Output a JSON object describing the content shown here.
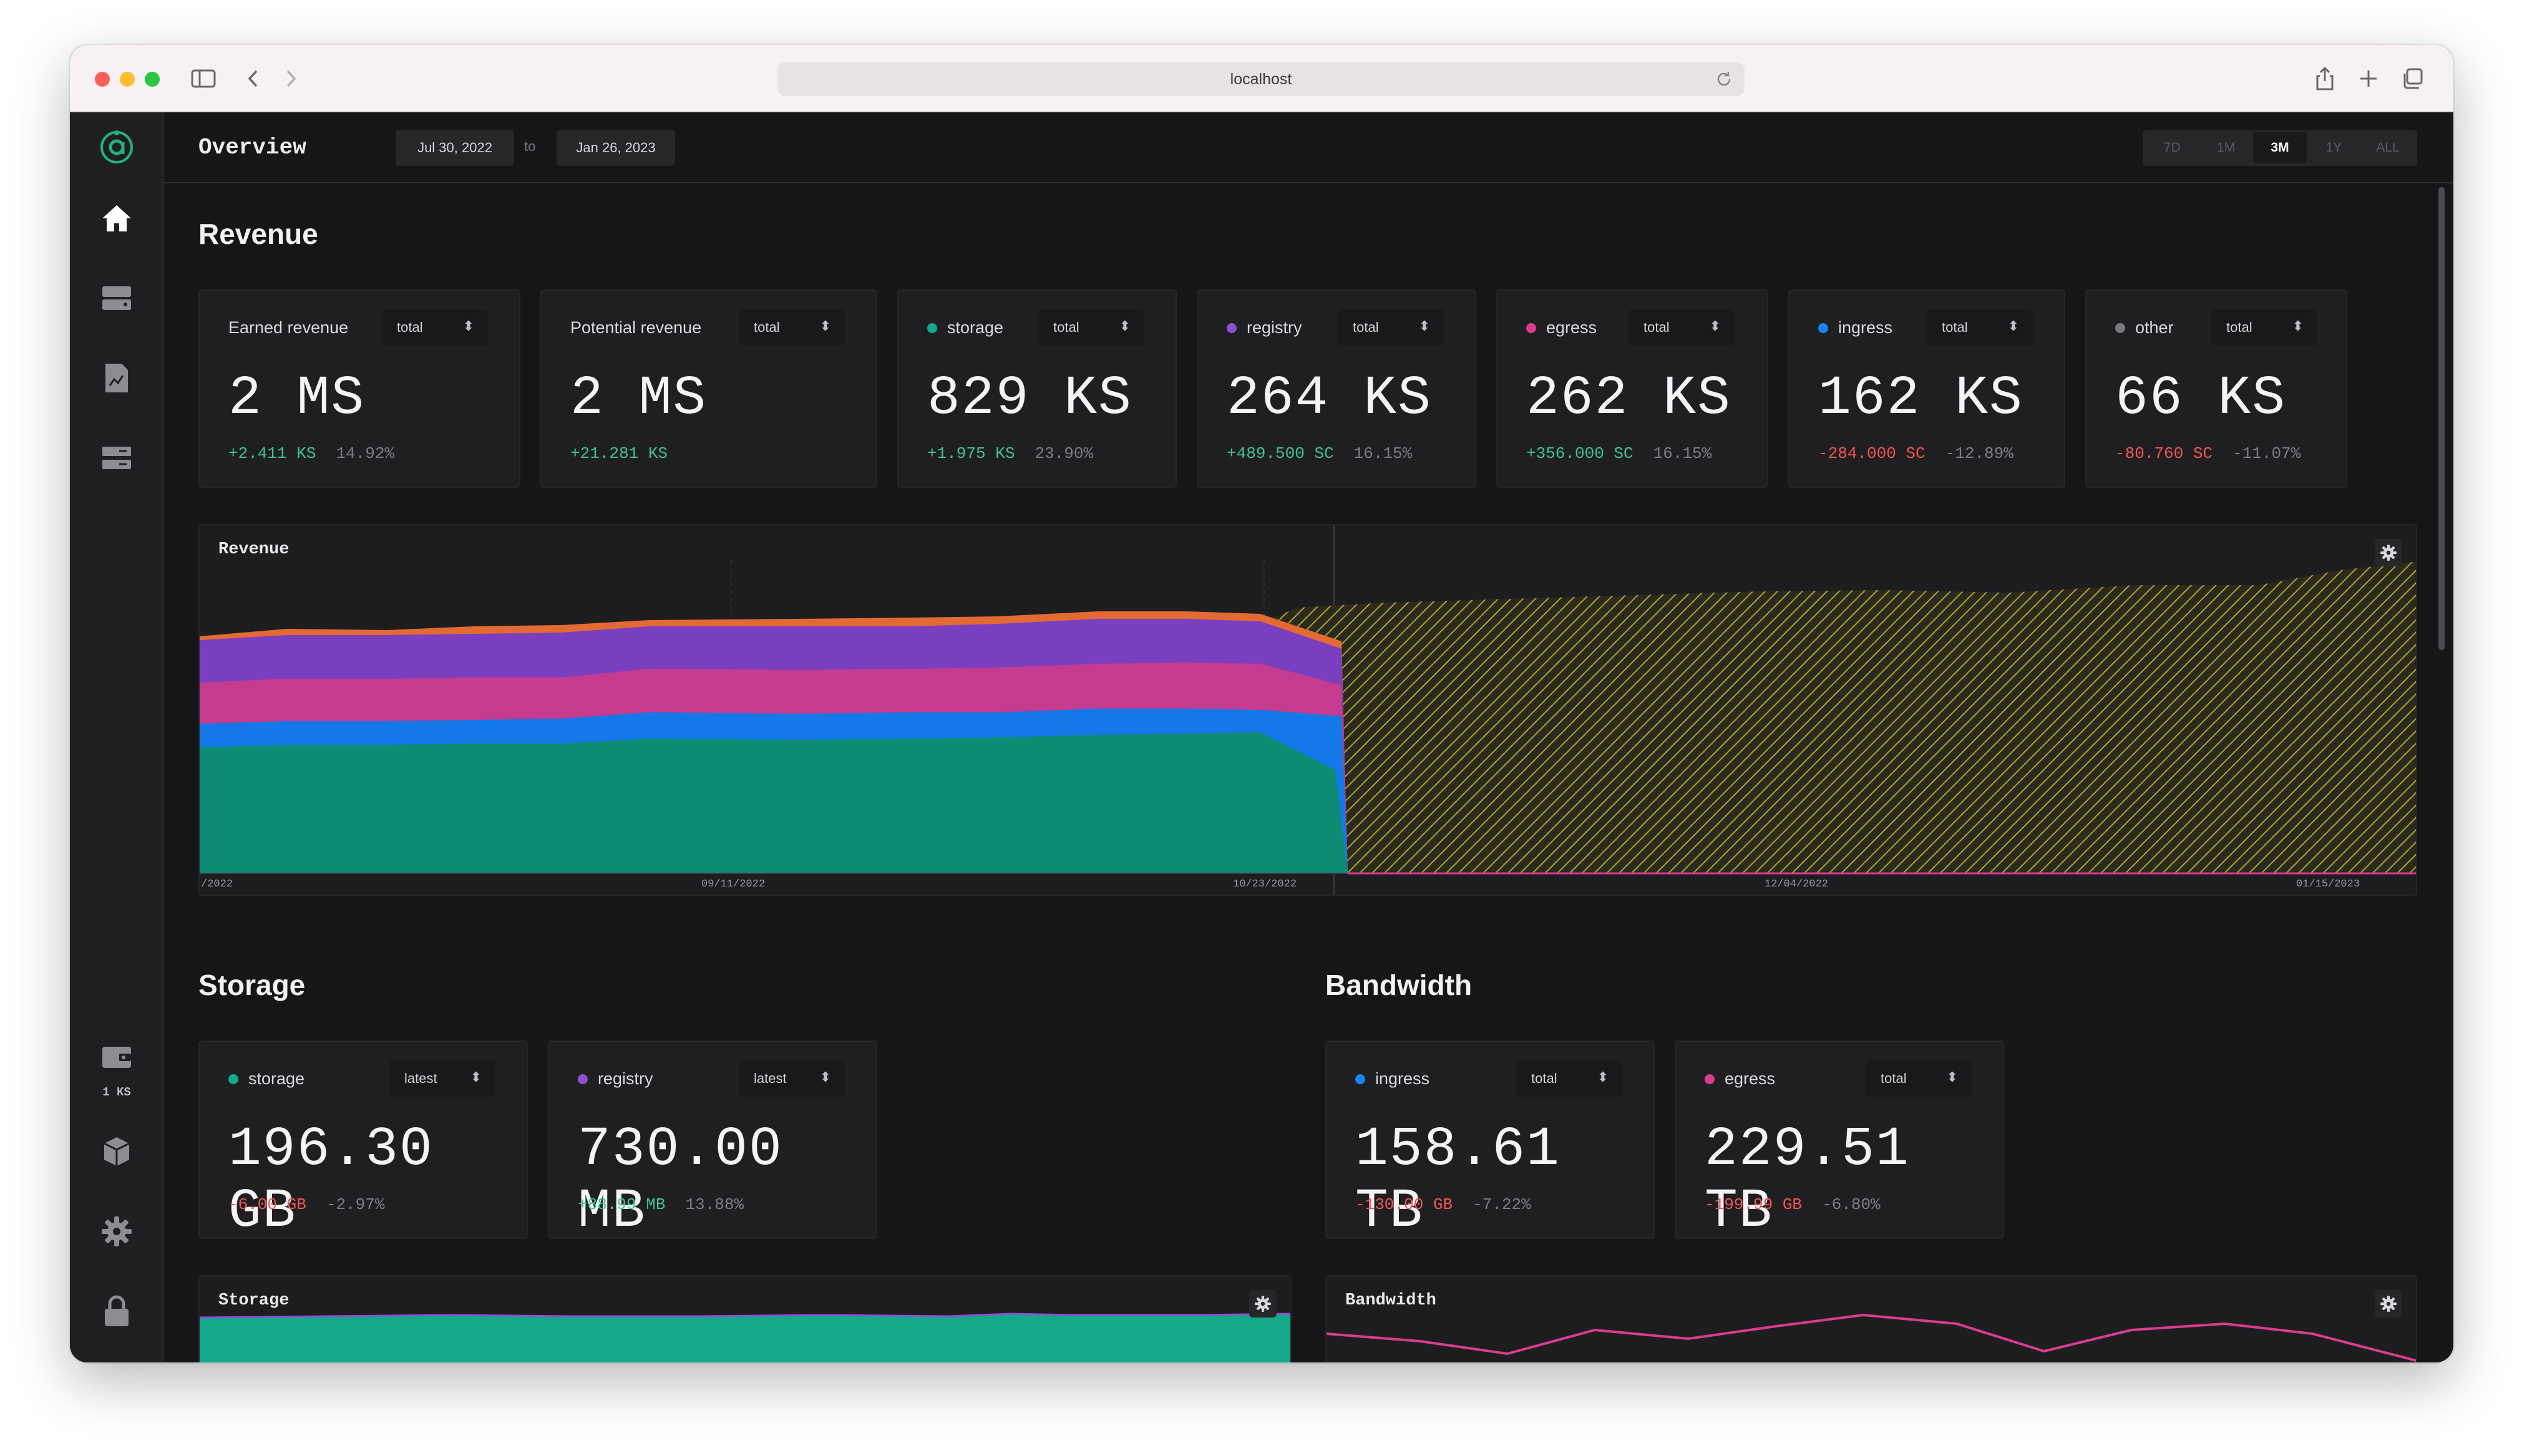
{
  "browser": {
    "url": "localhost",
    "colors": {
      "close": "#ff5f57",
      "minimize": "#febc2e",
      "zoom": "#28c840"
    }
  },
  "sidebar": {
    "items": [
      {
        "icon": "logo-icon"
      },
      {
        "icon": "home-icon",
        "active": true
      },
      {
        "icon": "storage-icon"
      },
      {
        "icon": "contracts-icon"
      },
      {
        "icon": "volumes-icon"
      }
    ],
    "bottom": [
      {
        "icon": "wallet-icon",
        "label": "1 KS"
      },
      {
        "icon": "box-icon"
      },
      {
        "icon": "gear-icon"
      },
      {
        "icon": "lock-icon"
      }
    ]
  },
  "header": {
    "title": "Overview",
    "date_from": "Jul 30, 2022",
    "date_to_label": "to",
    "date_to": "Jan 26, 2023",
    "periods": [
      "7D",
      "1M",
      "3M",
      "1Y",
      "ALL"
    ],
    "active_period": "3M"
  },
  "revenue": {
    "title": "Revenue",
    "cards": [
      {
        "label": "Earned revenue",
        "selector": "total",
        "value": "2 MS",
        "delta": "+2.411 KS",
        "pct": "14.92%",
        "trend": "pos",
        "dot": null
      },
      {
        "label": "Potential revenue",
        "selector": "total",
        "value": "2 MS",
        "delta": "+21.281 KS",
        "pct": "",
        "trend": "pos",
        "dot": null
      },
      {
        "label": "storage",
        "selector": "total",
        "value": "829 KS",
        "delta": "+1.975 KS",
        "pct": "23.90%",
        "trend": "pos",
        "dot": "#14a98a"
      },
      {
        "label": "registry",
        "selector": "total",
        "value": "264 KS",
        "delta": "+489.500 SC",
        "pct": "16.15%",
        "trend": "pos",
        "dot": "#8e4fd3"
      },
      {
        "label": "egress",
        "selector": "total",
        "value": "262 KS",
        "delta": "+356.000 SC",
        "pct": "16.15%",
        "trend": "pos",
        "dot": "#d93c8f"
      },
      {
        "label": "ingress",
        "selector": "total",
        "value": "162 KS",
        "delta": "-284.000 SC",
        "pct": "-12.89%",
        "trend": "neg",
        "dot": "#1685f5"
      },
      {
        "label": "other",
        "selector": "total",
        "value": "66 KS",
        "delta": "-80.760 SC",
        "pct": "-11.07%",
        "trend": "neg",
        "dot": "#7a7a7f"
      }
    ],
    "chart": {
      "label": "Revenue",
      "x_ticks": [
        "/2022",
        "09/11/2022",
        "10/23/2022",
        "12/04/2022",
        "01/15/2023"
      ]
    }
  },
  "storage": {
    "title": "Storage",
    "cards": [
      {
        "label": "storage",
        "selector": "latest",
        "value": "196.30 GB",
        "delta": "-6.00 GB",
        "pct": "-2.97%",
        "trend": "neg",
        "dot": "#14a98a"
      },
      {
        "label": "registry",
        "selector": "latest",
        "value": "730.00 MB",
        "delta": "+88.99 MB",
        "pct": "13.88%",
        "trend": "pos",
        "dot": "#8e4fd3"
      }
    ],
    "chart": {
      "label": "Storage"
    }
  },
  "bandwidth": {
    "title": "Bandwidth",
    "cards": [
      {
        "label": "ingress",
        "selector": "total",
        "value": "158.61 TB",
        "delta": "-130.00 GB",
        "pct": "-7.22%",
        "trend": "neg",
        "dot": "#1685f5"
      },
      {
        "label": "egress",
        "selector": "total",
        "value": "229.51 TB",
        "delta": "-199.99 GB",
        "pct": "-6.80%",
        "trend": "neg",
        "dot": "#d93c8f"
      }
    ],
    "chart": {
      "label": "Bandwidth"
    }
  }
}
